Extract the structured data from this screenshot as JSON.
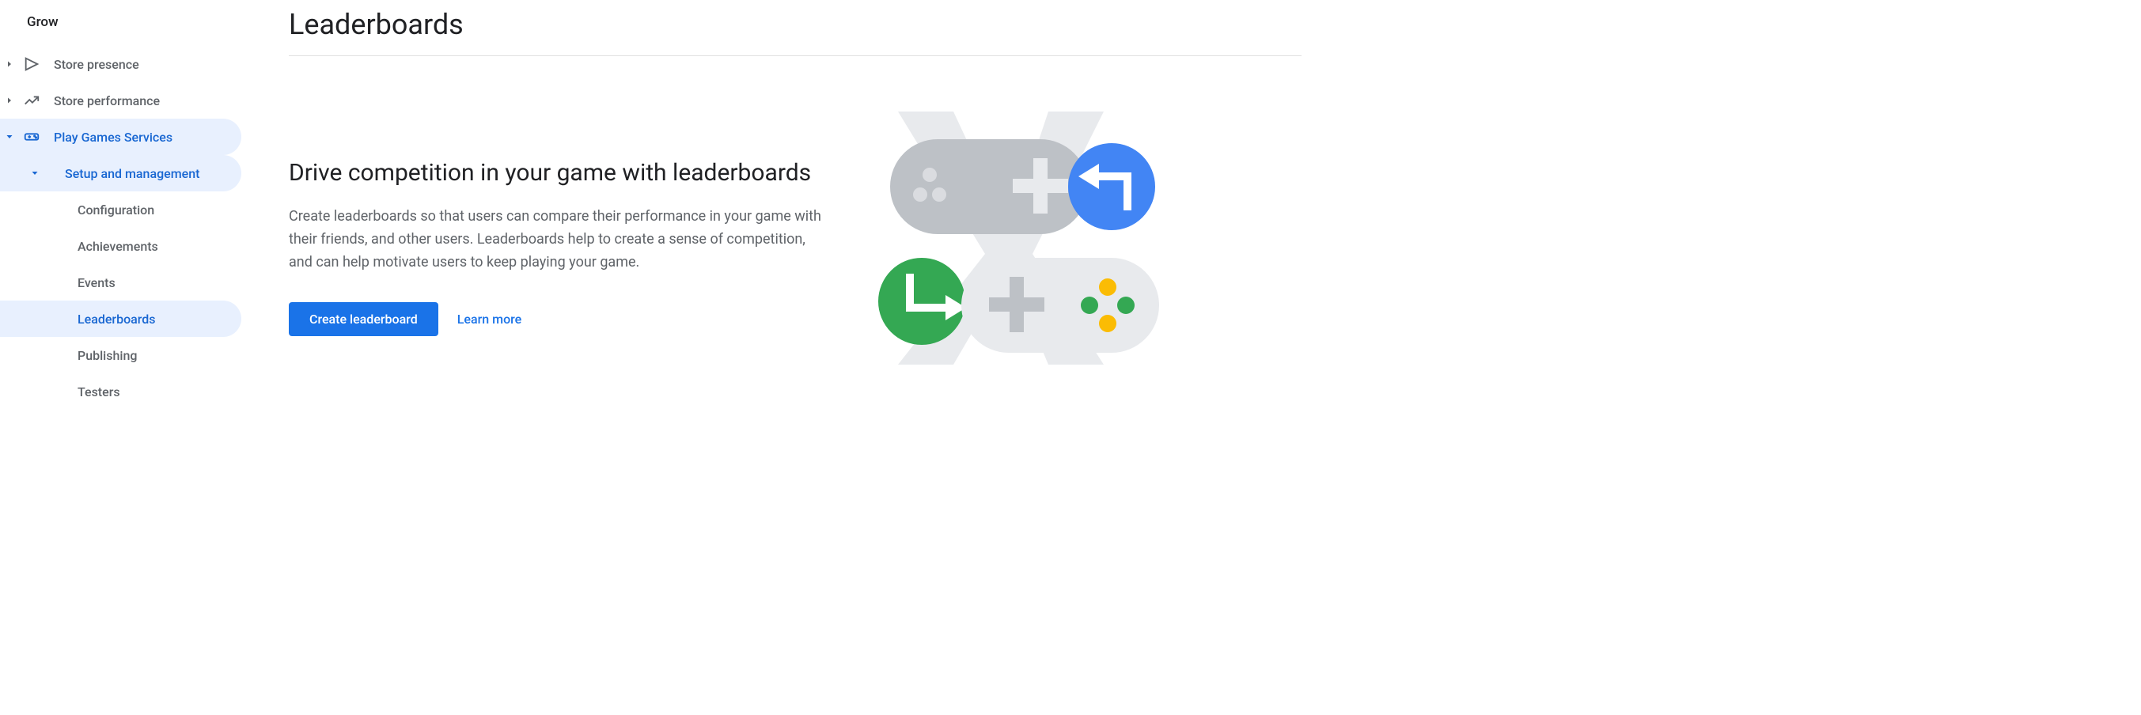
{
  "sidebar": {
    "section_label": "Grow",
    "items": [
      {
        "label": "Store presence"
      },
      {
        "label": "Store performance"
      },
      {
        "label": "Play Games Services"
      },
      {
        "label": "Setup and management"
      },
      {
        "label": "Configuration"
      },
      {
        "label": "Achievements"
      },
      {
        "label": "Events"
      },
      {
        "label": "Leaderboards"
      },
      {
        "label": "Publishing"
      },
      {
        "label": "Testers"
      }
    ]
  },
  "main": {
    "title": "Leaderboards",
    "heading": "Drive competition in your game with leaderboards",
    "description": "Create leaderboards so that users can compare their performance in your game with their friends, and other users. Leaderboards help to create a sense of competition, and can help motivate users to keep playing your game.",
    "create_button": "Create leaderboard",
    "learn_more": "Learn more"
  }
}
